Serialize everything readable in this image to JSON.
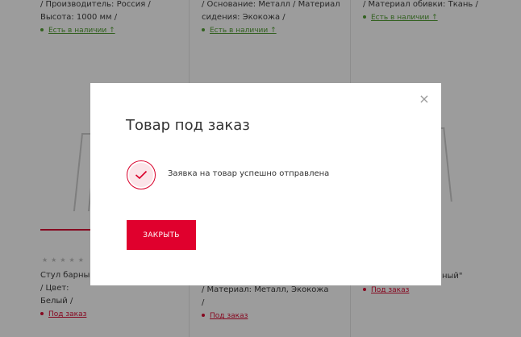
{
  "background": {
    "col1_top_text": "/ Производитель: Россия / Высота: 1000 мм /",
    "col1_avail": "Есть в наличии ↑",
    "col2_top_text": "/ Основание: Металл / Материал сидения: Экокожа /",
    "col2_avail": "Есть в наличии ↑",
    "col3_top_text": "/ Материал обивки: Ткань /",
    "col3_avail": "Есть в наличии ↑",
    "col1_lower_title": "Стул барны",
    "col1_lower_attr": "/ Цвет: Белый /",
    "col1_order": "Под заказ",
    "col2_lower_attr": "/ Материал: Металл, Экокожа /",
    "col2_order": "Под заказ",
    "col3_lower_title": "ный\"",
    "col3_order": "Под заказ",
    "stars": "★★★★★"
  },
  "modal": {
    "title": "Товар под заказ",
    "close_icon": "×",
    "success_message": "Заявка на товар успешно отправлена",
    "close_button_label": "ЗАКРЫТЬ"
  },
  "colors": {
    "accent": "#e0002d",
    "success_circle_fill": "#fbe4e8",
    "in_stock": "#4a9a2a",
    "overlay": "rgba(20,20,20,0.42)"
  }
}
